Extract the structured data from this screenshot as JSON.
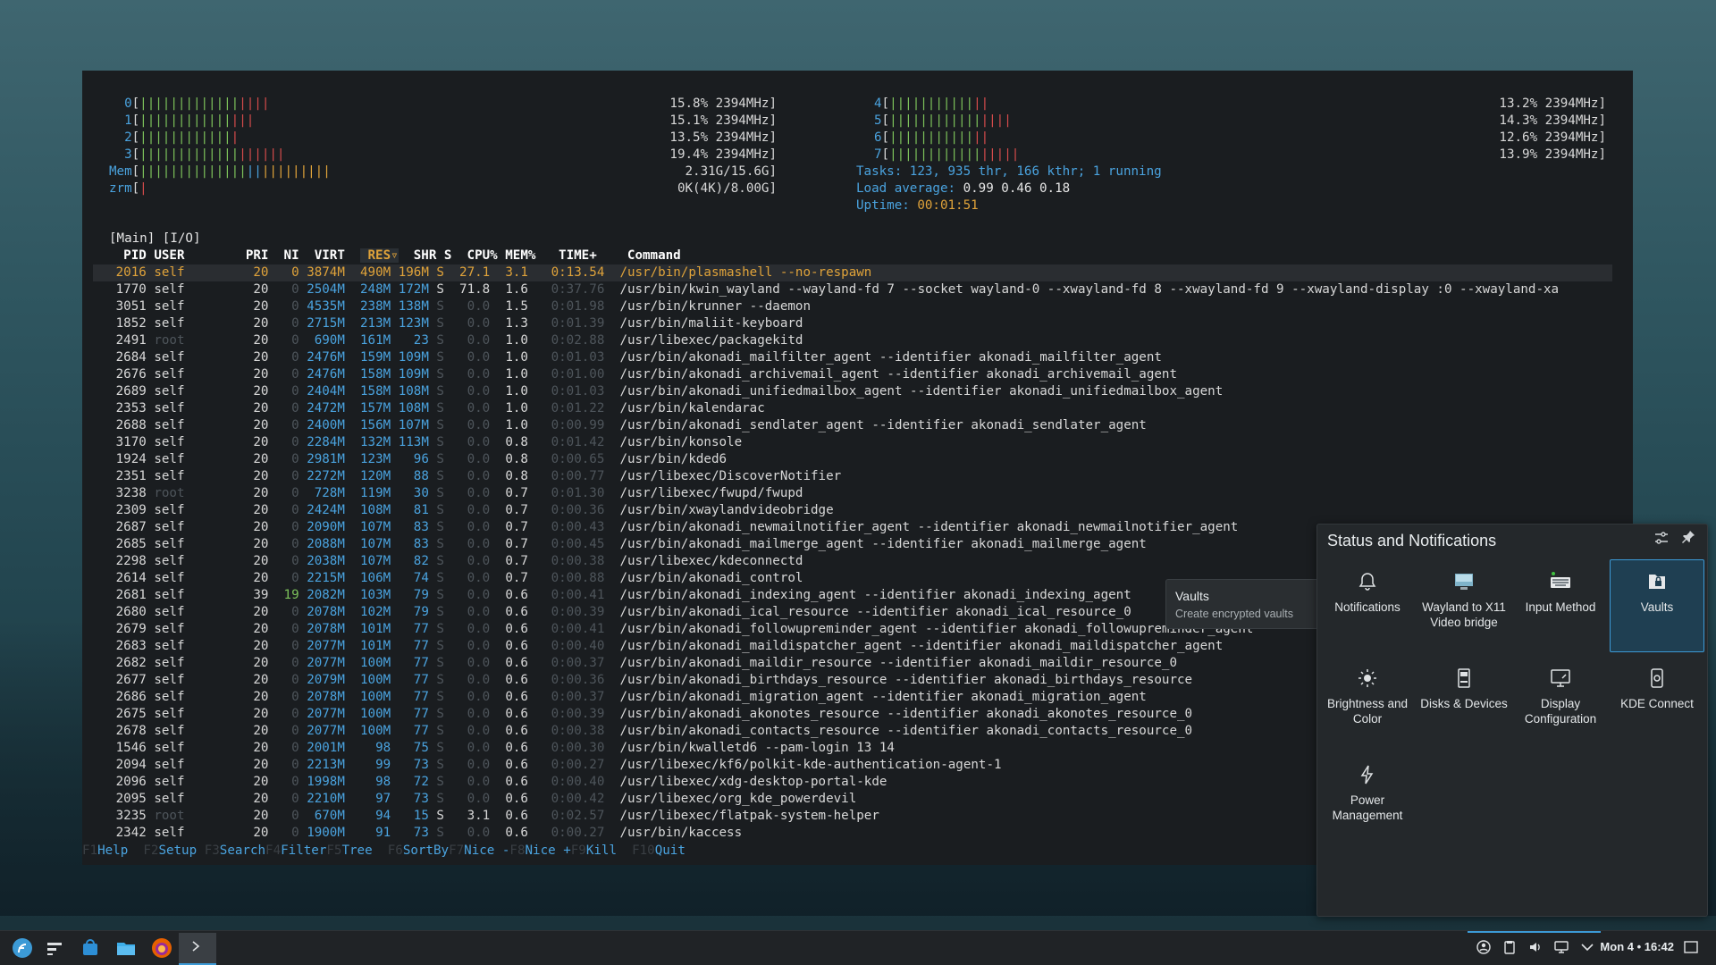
{
  "cpu_meters": [
    {
      "label": "0",
      "pct": "15.8% 2394MHz"
    },
    {
      "label": "1",
      "pct": "15.1% 2394MHz"
    },
    {
      "label": "2",
      "pct": "13.5% 2394MHz"
    },
    {
      "label": "3",
      "pct": "19.4% 2394MHz"
    },
    {
      "label": "4",
      "pct": "13.2% 2394MHz"
    },
    {
      "label": "5",
      "pct": "14.3% 2394MHz"
    },
    {
      "label": "6",
      "pct": "12.6% 2394MHz"
    },
    {
      "label": "7",
      "pct": "13.9% 2394MHz"
    }
  ],
  "mem": {
    "label": "Mem",
    "value": "2.31G/15.6G"
  },
  "zrm": {
    "label": "zrm",
    "value": "0K(4K)/8.00G"
  },
  "tasks": {
    "prefix": "Tasks: ",
    "value": "123, 935 thr, 166 kthr; ",
    "running": "1 running"
  },
  "load": {
    "prefix": "Load average: ",
    "value": "0.99 0.46 0.18"
  },
  "uptime": {
    "prefix": "Uptime: ",
    "value": "00:01:51"
  },
  "tabs": "[Main] [I/O]",
  "columns": [
    "PID",
    "USER",
    "PRI",
    "NI",
    "VIRT",
    "RES▿",
    "SHR",
    "S",
    "CPU%",
    "MEM%",
    "TIME+",
    "Command"
  ],
  "processes": [
    {
      "pid": "2016",
      "user": "self",
      "pri": "20",
      "ni": "0",
      "virt": "3874M",
      "res": "490M",
      "shr": "196M",
      "s": "S",
      "cpu": "27.1",
      "mem": "3.1",
      "time": "0:13.54",
      "cmd": "/usr/bin/plasmashell --no-respawn"
    },
    {
      "pid": "1770",
      "user": "self",
      "pri": "20",
      "ni": "0",
      "virt": "2504M",
      "res": "248M",
      "shr": "172M",
      "s": "S",
      "cpu": "71.8",
      "mem": "1.6",
      "time": "0:37.76",
      "cmd": "/usr/bin/kwin_wayland --wayland-fd 7 --socket wayland-0 --xwayland-fd 8 --xwayland-fd 9 --xwayland-display :0 --xwayland-xa"
    },
    {
      "pid": "3051",
      "user": "self",
      "pri": "20",
      "ni": "0",
      "virt": "4535M",
      "res": "238M",
      "shr": "138M",
      "s": "S",
      "cpu": "0.0",
      "mem": "1.5",
      "time": "0:01.98",
      "cmd": "/usr/bin/krunner --daemon"
    },
    {
      "pid": "1852",
      "user": "self",
      "pri": "20",
      "ni": "0",
      "virt": "2715M",
      "res": "213M",
      "shr": "123M",
      "s": "S",
      "cpu": "0.0",
      "mem": "1.3",
      "time": "0:01.39",
      "cmd": "/usr/bin/maliit-keyboard"
    },
    {
      "pid": "2491",
      "user": "root",
      "pri": "20",
      "ni": "0",
      "virt": "690M",
      "res": "161M",
      "shr": "23",
      "s": "S",
      "cpu": "0.0",
      "mem": "1.0",
      "time": "0:02.88",
      "cmd": "/usr/libexec/packagekitd"
    },
    {
      "pid": "2684",
      "user": "self",
      "pri": "20",
      "ni": "0",
      "virt": "2476M",
      "res": "159M",
      "shr": "109M",
      "s": "S",
      "cpu": "0.0",
      "mem": "1.0",
      "time": "0:01.03",
      "cmd": "/usr/bin/akonadi_mailfilter_agent --identifier akonadi_mailfilter_agent"
    },
    {
      "pid": "2676",
      "user": "self",
      "pri": "20",
      "ni": "0",
      "virt": "2476M",
      "res": "158M",
      "shr": "109M",
      "s": "S",
      "cpu": "0.0",
      "mem": "1.0",
      "time": "0:01.00",
      "cmd": "/usr/bin/akonadi_archivemail_agent --identifier akonadi_archivemail_agent"
    },
    {
      "pid": "2689",
      "user": "self",
      "pri": "20",
      "ni": "0",
      "virt": "2404M",
      "res": "158M",
      "shr": "108M",
      "s": "S",
      "cpu": "0.0",
      "mem": "1.0",
      "time": "0:01.03",
      "cmd": "/usr/bin/akonadi_unifiedmailbox_agent --identifier akonadi_unifiedmailbox_agent"
    },
    {
      "pid": "2353",
      "user": "self",
      "pri": "20",
      "ni": "0",
      "virt": "2472M",
      "res": "157M",
      "shr": "108M",
      "s": "S",
      "cpu": "0.0",
      "mem": "1.0",
      "time": "0:01.22",
      "cmd": "/usr/bin/kalendarac"
    },
    {
      "pid": "2688",
      "user": "self",
      "pri": "20",
      "ni": "0",
      "virt": "2400M",
      "res": "156M",
      "shr": "107M",
      "s": "S",
      "cpu": "0.0",
      "mem": "1.0",
      "time": "0:00.99",
      "cmd": "/usr/bin/akonadi_sendlater_agent --identifier akonadi_sendlater_agent"
    },
    {
      "pid": "3170",
      "user": "self",
      "pri": "20",
      "ni": "0",
      "virt": "2284M",
      "res": "132M",
      "shr": "113M",
      "s": "S",
      "cpu": "0.0",
      "mem": "0.8",
      "time": "0:01.42",
      "cmd": "/usr/bin/konsole"
    },
    {
      "pid": "1924",
      "user": "self",
      "pri": "20",
      "ni": "0",
      "virt": "2981M",
      "res": "123M",
      "shr": "96",
      "s": "S",
      "cpu": "0.0",
      "mem": "0.8",
      "time": "0:00.65",
      "cmd": "/usr/bin/kded6"
    },
    {
      "pid": "2351",
      "user": "self",
      "pri": "20",
      "ni": "0",
      "virt": "2272M",
      "res": "120M",
      "shr": "88",
      "s": "S",
      "cpu": "0.0",
      "mem": "0.8",
      "time": "0:00.77",
      "cmd": "/usr/libexec/DiscoverNotifier"
    },
    {
      "pid": "3238",
      "user": "root",
      "pri": "20",
      "ni": "0",
      "virt": "728M",
      "res": "119M",
      "shr": "30",
      "s": "S",
      "cpu": "0.0",
      "mem": "0.7",
      "time": "0:01.30",
      "cmd": "/usr/libexec/fwupd/fwupd"
    },
    {
      "pid": "2309",
      "user": "self",
      "pri": "20",
      "ni": "0",
      "virt": "2424M",
      "res": "108M",
      "shr": "81",
      "s": "S",
      "cpu": "0.0",
      "mem": "0.7",
      "time": "0:00.36",
      "cmd": "/usr/bin/xwaylandvideobridge"
    },
    {
      "pid": "2687",
      "user": "self",
      "pri": "20",
      "ni": "0",
      "virt": "2090M",
      "res": "107M",
      "shr": "83",
      "s": "S",
      "cpu": "0.0",
      "mem": "0.7",
      "time": "0:00.43",
      "cmd": "/usr/bin/akonadi_newmailnotifier_agent --identifier akonadi_newmailnotifier_agent"
    },
    {
      "pid": "2685",
      "user": "self",
      "pri": "20",
      "ni": "0",
      "virt": "2088M",
      "res": "107M",
      "shr": "83",
      "s": "S",
      "cpu": "0.0",
      "mem": "0.7",
      "time": "0:00.45",
      "cmd": "/usr/bin/akonadi_mailmerge_agent --identifier akonadi_mailmerge_agent"
    },
    {
      "pid": "2298",
      "user": "self",
      "pri": "20",
      "ni": "0",
      "virt": "2038M",
      "res": "107M",
      "shr": "82",
      "s": "S",
      "cpu": "0.0",
      "mem": "0.7",
      "time": "0:00.38",
      "cmd": "/usr/libexec/kdeconnectd"
    },
    {
      "pid": "2614",
      "user": "self",
      "pri": "20",
      "ni": "0",
      "virt": "2215M",
      "res": "106M",
      "shr": "74",
      "s": "S",
      "cpu": "0.0",
      "mem": "0.7",
      "time": "0:00.88",
      "cmd": "/usr/bin/akonadi_control"
    },
    {
      "pid": "2681",
      "user": "self",
      "pri": "39",
      "ni": "19",
      "virt": "2082M",
      "res": "103M",
      "shr": "79",
      "s": "S",
      "cpu": "0.0",
      "mem": "0.6",
      "time": "0:00.41",
      "cmd": "/usr/bin/akonadi_indexing_agent --identifier akonadi_indexing_agent"
    },
    {
      "pid": "2680",
      "user": "self",
      "pri": "20",
      "ni": "0",
      "virt": "2078M",
      "res": "102M",
      "shr": "79",
      "s": "S",
      "cpu": "0.0",
      "mem": "0.6",
      "time": "0:00.39",
      "cmd": "/usr/bin/akonadi_ical_resource --identifier akonadi_ical_resource_0"
    },
    {
      "pid": "2679",
      "user": "self",
      "pri": "20",
      "ni": "0",
      "virt": "2078M",
      "res": "101M",
      "shr": "77",
      "s": "S",
      "cpu": "0.0",
      "mem": "0.6",
      "time": "0:00.41",
      "cmd": "/usr/bin/akonadi_followupreminder_agent --identifier akonadi_followupreminder_agent"
    },
    {
      "pid": "2683",
      "user": "self",
      "pri": "20",
      "ni": "0",
      "virt": "2077M",
      "res": "101M",
      "shr": "77",
      "s": "S",
      "cpu": "0.0",
      "mem": "0.6",
      "time": "0:00.40",
      "cmd": "/usr/bin/akonadi_maildispatcher_agent --identifier akonadi_maildispatcher_agent"
    },
    {
      "pid": "2682",
      "user": "self",
      "pri": "20",
      "ni": "0",
      "virt": "2077M",
      "res": "100M",
      "shr": "77",
      "s": "S",
      "cpu": "0.0",
      "mem": "0.6",
      "time": "0:00.37",
      "cmd": "/usr/bin/akonadi_maildir_resource --identifier akonadi_maildir_resource_0"
    },
    {
      "pid": "2677",
      "user": "self",
      "pri": "20",
      "ni": "0",
      "virt": "2079M",
      "res": "100M",
      "shr": "77",
      "s": "S",
      "cpu": "0.0",
      "mem": "0.6",
      "time": "0:00.36",
      "cmd": "/usr/bin/akonadi_birthdays_resource --identifier akonadi_birthdays_resource"
    },
    {
      "pid": "2686",
      "user": "self",
      "pri": "20",
      "ni": "0",
      "virt": "2078M",
      "res": "100M",
      "shr": "77",
      "s": "S",
      "cpu": "0.0",
      "mem": "0.6",
      "time": "0:00.37",
      "cmd": "/usr/bin/akonadi_migration_agent --identifier akonadi_migration_agent"
    },
    {
      "pid": "2675",
      "user": "self",
      "pri": "20",
      "ni": "0",
      "virt": "2077M",
      "res": "100M",
      "shr": "77",
      "s": "S",
      "cpu": "0.0",
      "mem": "0.6",
      "time": "0:00.39",
      "cmd": "/usr/bin/akonadi_akonotes_resource --identifier akonadi_akonotes_resource_0"
    },
    {
      "pid": "2678",
      "user": "self",
      "pri": "20",
      "ni": "0",
      "virt": "2077M",
      "res": "100M",
      "shr": "77",
      "s": "S",
      "cpu": "0.0",
      "mem": "0.6",
      "time": "0:00.38",
      "cmd": "/usr/bin/akonadi_contacts_resource --identifier akonadi_contacts_resource_0"
    },
    {
      "pid": "1546",
      "user": "self",
      "pri": "20",
      "ni": "0",
      "virt": "2001M",
      "res": "98",
      "shr": "75",
      "s": "S",
      "cpu": "0.0",
      "mem": "0.6",
      "time": "0:00.30",
      "cmd": "/usr/bin/kwalletd6 --pam-login 13 14"
    },
    {
      "pid": "2094",
      "user": "self",
      "pri": "20",
      "ni": "0",
      "virt": "2213M",
      "res": "99",
      "shr": "73",
      "s": "S",
      "cpu": "0.0",
      "mem": "0.6",
      "time": "0:00.27",
      "cmd": "/usr/libexec/kf6/polkit-kde-authentication-agent-1"
    },
    {
      "pid": "2096",
      "user": "self",
      "pri": "20",
      "ni": "0",
      "virt": "1998M",
      "res": "98",
      "shr": "72",
      "s": "S",
      "cpu": "0.0",
      "mem": "0.6",
      "time": "0:00.40",
      "cmd": "/usr/libexec/xdg-desktop-portal-kde"
    },
    {
      "pid": "2095",
      "user": "self",
      "pri": "20",
      "ni": "0",
      "virt": "2210M",
      "res": "97",
      "shr": "73",
      "s": "S",
      "cpu": "0.0",
      "mem": "0.6",
      "time": "0:00.42",
      "cmd": "/usr/libexec/org_kde_powerdevil"
    },
    {
      "pid": "3235",
      "user": "root",
      "pri": "20",
      "ni": "0",
      "virt": "670M",
      "res": "94",
      "shr": "15",
      "s": "S",
      "cpu": "3.1",
      "mem": "0.6",
      "time": "0:02.57",
      "cmd": "/usr/libexec/flatpak-system-helper"
    },
    {
      "pid": "2342",
      "user": "self",
      "pri": "20",
      "ni": "0",
      "virt": "1900M",
      "res": "91",
      "shr": "73",
      "s": "S",
      "cpu": "0.0",
      "mem": "0.6",
      "time": "0:00.27",
      "cmd": "/usr/bin/kaccess"
    }
  ],
  "footer": [
    {
      "key": "F1",
      "label": "Help  "
    },
    {
      "key": "F2",
      "label": "Setup "
    },
    {
      "key": "F3",
      "label": "Search"
    },
    {
      "key": "F4",
      "label": "Filter"
    },
    {
      "key": "F5",
      "label": "Tree  "
    },
    {
      "key": "F6",
      "label": "SortBy"
    },
    {
      "key": "F7",
      "label": "Nice -"
    },
    {
      "key": "F8",
      "label": "Nice +"
    },
    {
      "key": "F9",
      "label": "Kill  "
    },
    {
      "key": "F10",
      "label": "Quit"
    }
  ],
  "popup": {
    "title": "Status and Notifications",
    "tiles": [
      {
        "label": "Notifications",
        "icon": "bell-icon"
      },
      {
        "label": "Wayland to X11 Video bridge",
        "icon": "video-bridge-icon"
      },
      {
        "label": "Input Method",
        "icon": "keyboard-icon"
      },
      {
        "label": "Vaults",
        "icon": "vault-icon"
      },
      {
        "label": "Brightness and Color",
        "icon": "brightness-icon"
      },
      {
        "label": "Disks & Devices",
        "icon": "disk-icon"
      },
      {
        "label": "Display Configuration",
        "icon": "display-icon"
      },
      {
        "label": "KDE Connect",
        "icon": "phone-icon"
      },
      {
        "label": "Power Management",
        "icon": "power-icon"
      }
    ]
  },
  "tooltip": {
    "title": "Vaults",
    "subtitle": "Create encrypted vaults"
  },
  "taskbar": {
    "clock": "Mon 4 • 16:42"
  },
  "colors": {
    "accent": "#3c9ad6",
    "terminal_bg": "#1a1d20",
    "popup_bg": "#24282b"
  }
}
